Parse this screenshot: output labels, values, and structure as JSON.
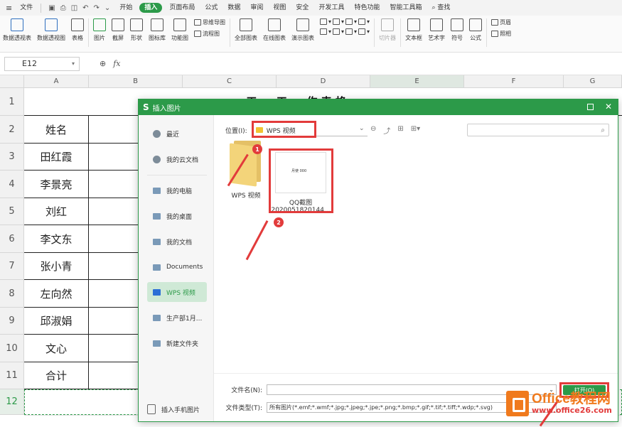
{
  "menubar": {
    "file": "文件",
    "tabs": [
      "开始",
      "插入",
      "页面布局",
      "公式",
      "数据",
      "审阅",
      "视图",
      "安全",
      "开发工具",
      "特色功能",
      "智能工具箱"
    ],
    "active_tab": "插入",
    "search": "查找"
  },
  "ribbon": {
    "items": [
      "数据透视表",
      "数据透视图",
      "表格",
      "图片",
      "截屏",
      "形状",
      "图标库",
      "功能图"
    ],
    "col1": [
      "思维导图",
      "流程图"
    ],
    "items2": [
      "全部图表",
      "在线图表",
      "演示图表"
    ],
    "items3": [
      "切片器",
      "文本框",
      "艺术字",
      "符号",
      "公式"
    ],
    "right": [
      "页眉",
      "照相"
    ]
  },
  "formula": {
    "cell_ref": "E12",
    "fx": "fx"
  },
  "sheet": {
    "columns": [
      "A",
      "B",
      "C",
      "D",
      "E",
      "F",
      "G"
    ],
    "rows": [
      "1",
      "2",
      "3",
      "4",
      "5",
      "6",
      "7",
      "8",
      "9",
      "10",
      "11",
      "12"
    ],
    "title_partial": "··· 工 ··· 工 ··· 作 表 格",
    "col_a": [
      "姓名",
      "田红霞",
      "李景亮",
      "刘红",
      "李文东",
      "张小青",
      "左向然",
      "邱淑娟",
      "文心",
      "合计"
    ]
  },
  "dialog": {
    "title": "插入图片",
    "sidebar": [
      "最近",
      "我的云文档",
      "我的电脑",
      "我的桌面",
      "我的文档",
      "Documents",
      "WPS 视频",
      "生产部1月...",
      "新建文件夹"
    ],
    "active_side": "WPS 视频",
    "phone": "插入手机图片",
    "location_label": "位置(I):",
    "location_value": "WPS 视频",
    "folder_name": "WPS 视频",
    "file_name_line1": "QQ截图",
    "file_name_line2": "2020051820144...",
    "thumb_text": "月使 000",
    "filename_label": "文件名(N):",
    "filetype_label": "文件类型(T):",
    "filetype_value": "所有图片(*.emf;*.wmf;*.jpg;*.jpeg;*.jpe;*.png;*.bmp;*.gif;*.tif;*.tiff;*.wdp;*.svg)",
    "open_button": "打开(O)",
    "badge1": "1",
    "badge2": "2"
  },
  "watermark": {
    "line1": "Office教程网",
    "line2": "www.office26.com"
  },
  "colors": {
    "accent": "#2c9a49",
    "highlight": "#e23b3b",
    "watermark": "#f07a1d"
  }
}
